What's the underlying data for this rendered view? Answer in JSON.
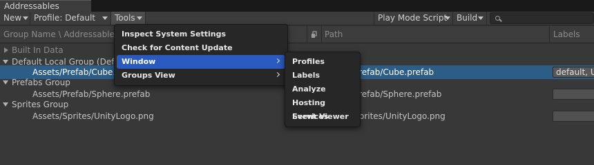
{
  "window": {
    "tab_title": "Addressables Groups"
  },
  "toolbar": {
    "new_label": "New",
    "profile_label": "Profile: Default",
    "tools_label": "Tools",
    "play_mode_label": "Play Mode Script",
    "build_label": "Build"
  },
  "columns": {
    "group_name": "Group Name \\ Addressable Name",
    "path": "Path",
    "labels": "Labels"
  },
  "tree": {
    "builtin": {
      "name": "Built In Data"
    },
    "default_group": {
      "name": "Default Local Group (Default)",
      "entry": {
        "name": "Assets/Prefab/Cube.prefab",
        "path": "Assets/Prefab/Cube.prefab",
        "labels": "default, UI"
      }
    },
    "prefabs_group": {
      "name": "Prefabs Group",
      "entry": {
        "name": "Assets/Prefab/Sphere.prefab",
        "path": "Assets/Prefab/Sphere.prefab"
      }
    },
    "sprites_group": {
      "name": "Sprites Group",
      "entry": {
        "name": "Assets/Sprites/UnityLogo.png",
        "path": "Assets/Sprites/UnityLogo.png"
      }
    }
  },
  "tools_menu": {
    "items": [
      {
        "label": "Inspect System Settings"
      },
      {
        "label": "Check for Content Update Restrictions"
      },
      {
        "label": "Window"
      },
      {
        "label": "Groups View"
      }
    ]
  },
  "window_submenu": {
    "items": [
      {
        "label": "Profiles"
      },
      {
        "label": "Labels"
      },
      {
        "label": "Analyze"
      },
      {
        "label": "Hosting Services"
      },
      {
        "label": "Event Viewer"
      }
    ]
  },
  "colors": {
    "background": "#383838",
    "selection": "#2c5d87",
    "menu_highlight": "#2a5ac0",
    "menu_background": "#272727"
  }
}
